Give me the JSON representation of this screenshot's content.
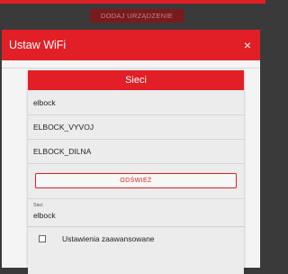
{
  "background": {
    "add_device_label": "DODAJ URZĄDZENIE"
  },
  "dialog": {
    "title": "Ustaw WiFi",
    "close_symbol": "×",
    "close_icon": "close-icon"
  },
  "networks": {
    "header": "Sieci",
    "items": [
      "elbock",
      "ELBOCK_VYVOJ",
      "ELBOCK_DILNA"
    ],
    "refresh_label": "ODŚWIEŻ"
  },
  "network_field": {
    "label": "Sieć",
    "value": "elbock"
  },
  "advanced": {
    "label": "Ustawienia zaawansowane",
    "checked": false
  },
  "colors": {
    "accent": "#e21f26",
    "panel": "#ececec",
    "modal": "#f4f4f4"
  }
}
